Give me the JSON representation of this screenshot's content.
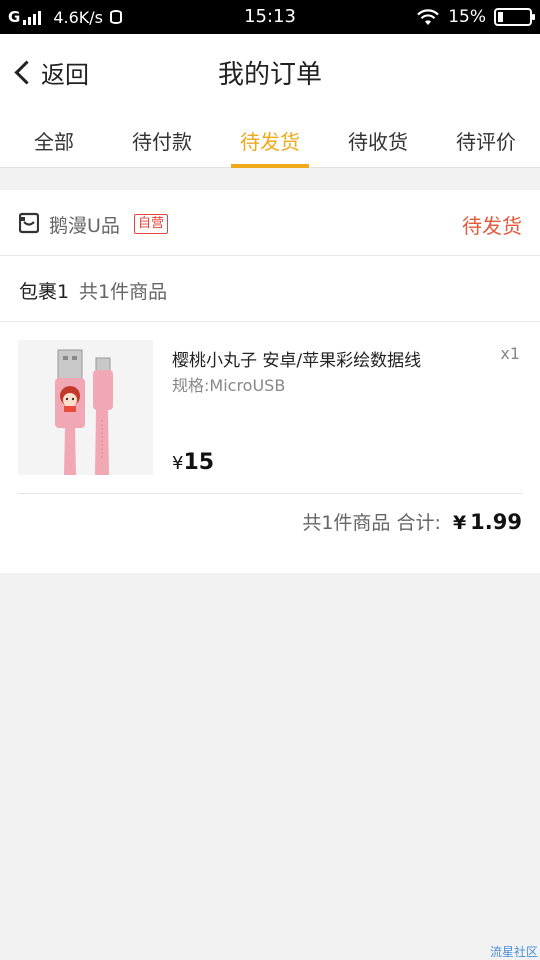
{
  "status_bar": {
    "network": "G",
    "speed": "4.6K/s",
    "time": "15:13",
    "battery": "15%",
    "battery_level": 0.15
  },
  "nav": {
    "back_label": "返回",
    "title": "我的订单"
  },
  "tabs": [
    {
      "label": "全部"
    },
    {
      "label": "待付款"
    },
    {
      "label": "待发货"
    },
    {
      "label": "待收货"
    },
    {
      "label": "待评价"
    }
  ],
  "active_tab": 2,
  "order": {
    "shop_name": "鹅漫U品",
    "shop_badge": "自营",
    "status": "待发货",
    "parcel_label": "包裹1",
    "parcel_count": "共1件商品",
    "item": {
      "title": "樱桃小丸子 安卓/苹果彩绘数据线",
      "spec": "规格:MicroUSB",
      "qty": "x1",
      "currency": "¥",
      "price": "15"
    },
    "summary": {
      "count": "共1件商品",
      "label": "合计:",
      "currency": "¥",
      "total": "1.99"
    }
  },
  "watermark": "流星社区",
  "colors": {
    "accent": "#f0a91c",
    "status": "#e5593d",
    "badge": "#e3453a",
    "background": "#f2f2f2"
  }
}
